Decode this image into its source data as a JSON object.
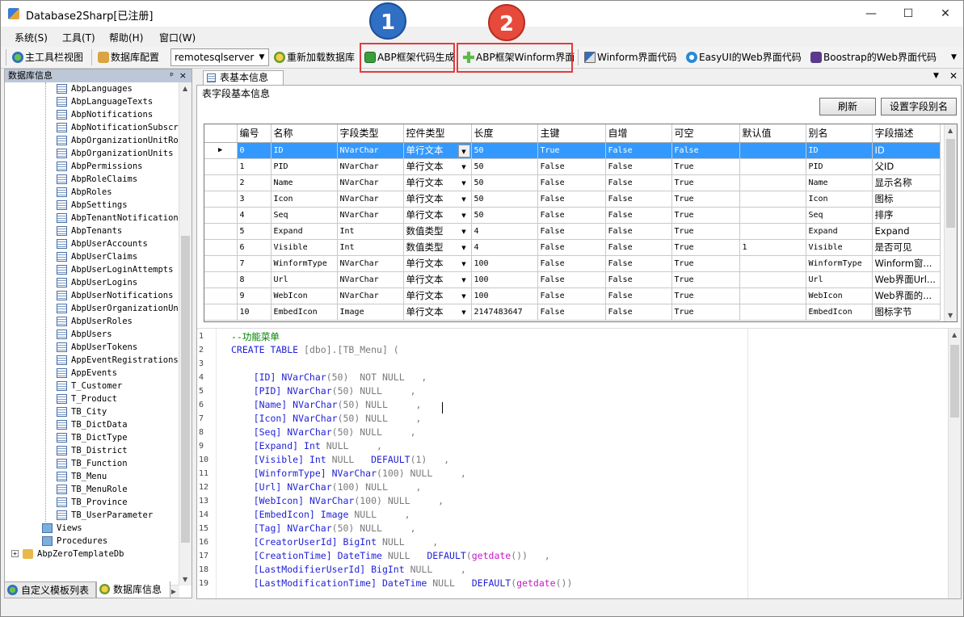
{
  "window": {
    "title": "Database2Sharp[已注册]"
  },
  "menubar": [
    "系统(S)",
    "工具(T)",
    "帮助(H)",
    "窗口(W)"
  ],
  "toolbar": {
    "main_toolbar_view": "主工具栏视图",
    "db_config": "数据库配置",
    "server_selected": "remotesqlserver",
    "reload_db": "重新加载数据库",
    "abp_code_gen": "ABP框架代码生成",
    "abp_winform_ui": "ABP框架Winform界面",
    "winform_ui_code": "Winform界面代码",
    "easyui_web_code": "EasyUI的Web界面代码",
    "bootstrap_web_code": "Boostrap的Web界面代码"
  },
  "badges": [
    "1",
    "2"
  ],
  "left_panel": {
    "title": "数据库信息",
    "pin": "ᵖ",
    "close": "×",
    "tables": [
      "AbpLanguages",
      "AbpLanguageTexts",
      "AbpNotifications",
      "AbpNotificationSubscri",
      "AbpOrganizationUnitRol",
      "AbpOrganizationUnits",
      "AbpPermissions",
      "AbpRoleClaims",
      "AbpRoles",
      "AbpSettings",
      "AbpTenantNotifications",
      "AbpTenants",
      "AbpUserAccounts",
      "AbpUserClaims",
      "AbpUserLoginAttempts",
      "AbpUserLogins",
      "AbpUserNotifications",
      "AbpUserOrganizationUni",
      "AbpUserRoles",
      "AbpUsers",
      "AbpUserTokens",
      "AppEventRegistrations",
      "AppEvents",
      "T_Customer",
      "T_Product",
      "TB_City",
      "TB_DictData",
      "TB_DictType",
      "TB_District",
      "TB_Function",
      "TB_Menu",
      "TB_MenuRole",
      "TB_Province",
      "TB_UserParameter"
    ],
    "views": "Views",
    "procedures": "Procedures",
    "db_node": "AbpZeroTemplateDb",
    "tabs": [
      "自定义模板列表",
      "数据库信息"
    ]
  },
  "doc_tab": "表基本信息",
  "section_label": "表字段基本信息",
  "buttons": {
    "refresh": "刷新",
    "set_alias": "设置字段别名"
  },
  "grid": {
    "columns": [
      "编号",
      "名称",
      "字段类型",
      "控件类型",
      "长度",
      "主键",
      "自增",
      "可空",
      "默认值",
      "别名",
      "字段描述"
    ],
    "rows": [
      [
        "0",
        "ID",
        "NVarChar",
        "单行文本",
        "50",
        "True",
        "False",
        "False",
        "",
        "ID",
        "ID"
      ],
      [
        "1",
        "PID",
        "NVarChar",
        "单行文本",
        "50",
        "False",
        "False",
        "True",
        "",
        "PID",
        "父ID"
      ],
      [
        "2",
        "Name",
        "NVarChar",
        "单行文本",
        "50",
        "False",
        "False",
        "True",
        "",
        "Name",
        "显示名称"
      ],
      [
        "3",
        "Icon",
        "NVarChar",
        "单行文本",
        "50",
        "False",
        "False",
        "True",
        "",
        "Icon",
        "图标"
      ],
      [
        "4",
        "Seq",
        "NVarChar",
        "单行文本",
        "50",
        "False",
        "False",
        "True",
        "",
        "Seq",
        "排序"
      ],
      [
        "5",
        "Expand",
        "Int",
        "数值类型",
        "4",
        "False",
        "False",
        "True",
        "",
        "Expand",
        "Expand"
      ],
      [
        "6",
        "Visible",
        "Int",
        "数值类型",
        "4",
        "False",
        "False",
        "True",
        "1",
        "Visible",
        "是否可见"
      ],
      [
        "7",
        "WinformType",
        "NVarChar",
        "单行文本",
        "100",
        "False",
        "False",
        "True",
        "",
        "WinformType",
        "Winform窗..."
      ],
      [
        "8",
        "Url",
        "NVarChar",
        "单行文本",
        "100",
        "False",
        "False",
        "True",
        "",
        "Url",
        "Web界面Url..."
      ],
      [
        "9",
        "WebIcon",
        "NVarChar",
        "单行文本",
        "100",
        "False",
        "False",
        "True",
        "",
        "WebIcon",
        "Web界面的..."
      ],
      [
        "10",
        "EmbedIcon",
        "Image",
        "单行文本",
        "2147483647",
        "False",
        "False",
        "True",
        "",
        "EmbedIcon",
        "图标字节"
      ]
    ]
  },
  "editor": {
    "line_numbers": [
      "1",
      "2",
      "3",
      "4",
      "5",
      "6",
      "7",
      "8",
      "9",
      "10",
      "11",
      "12",
      "13",
      "14",
      "15",
      "16",
      "17",
      "18",
      "19"
    ],
    "lines": [
      [
        {
          "t": "--功能菜单",
          "c": "cm"
        }
      ],
      [
        {
          "t": "CREATE TABLE ",
          "c": "kw"
        },
        {
          "t": "[dbo].[TB_Menu] (",
          "c": "gr"
        }
      ],
      [],
      [
        {
          "t": "    [ID] ",
          "c": "kw"
        },
        {
          "t": "NVarChar",
          "c": "kw"
        },
        {
          "t": "(50)  NOT NULL   ,",
          "c": "gr"
        }
      ],
      [
        {
          "t": "    [PID] ",
          "c": "kw"
        },
        {
          "t": "NVarChar",
          "c": "kw"
        },
        {
          "t": "(50) NULL     ,",
          "c": "gr"
        }
      ],
      [
        {
          "t": "    [Name] ",
          "c": "kw"
        },
        {
          "t": "NVarChar",
          "c": "kw"
        },
        {
          "t": "(50) NULL     ,",
          "c": "gr"
        }
      ],
      [
        {
          "t": "    [Icon] ",
          "c": "kw"
        },
        {
          "t": "NVarChar",
          "c": "kw"
        },
        {
          "t": "(50) NULL     ,",
          "c": "gr"
        }
      ],
      [
        {
          "t": "    [Seq] ",
          "c": "kw"
        },
        {
          "t": "NVarChar",
          "c": "kw"
        },
        {
          "t": "(50) NULL     ,",
          "c": "gr"
        }
      ],
      [
        {
          "t": "    [Expand] ",
          "c": "kw"
        },
        {
          "t": "Int",
          "c": "kw"
        },
        {
          "t": " NULL     ,",
          "c": "gr"
        }
      ],
      [
        {
          "t": "    [Visible] ",
          "c": "kw"
        },
        {
          "t": "Int",
          "c": "kw"
        },
        {
          "t": " NULL   ",
          "c": "gr"
        },
        {
          "t": "DEFAULT",
          "c": "kw"
        },
        {
          "t": "(1)   ,",
          "c": "gr"
        }
      ],
      [
        {
          "t": "    [WinformType] ",
          "c": "kw"
        },
        {
          "t": "NVarChar",
          "c": "kw"
        },
        {
          "t": "(100) NULL     ,",
          "c": "gr"
        }
      ],
      [
        {
          "t": "    [Url] ",
          "c": "kw"
        },
        {
          "t": "NVarChar",
          "c": "kw"
        },
        {
          "t": "(100) NULL     ,",
          "c": "gr"
        }
      ],
      [
        {
          "t": "    [WebIcon] ",
          "c": "kw"
        },
        {
          "t": "NVarChar",
          "c": "kw"
        },
        {
          "t": "(100) NULL     ,",
          "c": "gr"
        }
      ],
      [
        {
          "t": "    [EmbedIcon] ",
          "c": "kw"
        },
        {
          "t": "Image",
          "c": "kw"
        },
        {
          "t": " NULL     ,",
          "c": "gr"
        }
      ],
      [
        {
          "t": "    [Tag] ",
          "c": "kw"
        },
        {
          "t": "NVarChar",
          "c": "kw"
        },
        {
          "t": "(50) NULL     ,",
          "c": "gr"
        }
      ],
      [
        {
          "t": "    [CreatorUserId] ",
          "c": "kw"
        },
        {
          "t": "BigInt",
          "c": "kw"
        },
        {
          "t": " NULL     ,",
          "c": "gr"
        }
      ],
      [
        {
          "t": "    [CreationTime] ",
          "c": "kw"
        },
        {
          "t": "DateTime",
          "c": "kw"
        },
        {
          "t": " NULL   ",
          "c": "gr"
        },
        {
          "t": "DEFAULT",
          "c": "kw"
        },
        {
          "t": "(",
          "c": "gr"
        },
        {
          "t": "getdate",
          "c": "fn"
        },
        {
          "t": "())   ,",
          "c": "gr"
        }
      ],
      [
        {
          "t": "    [LastModifierUserId] ",
          "c": "kw"
        },
        {
          "t": "BigInt",
          "c": "kw"
        },
        {
          "t": " NULL     ,",
          "c": "gr"
        }
      ],
      [
        {
          "t": "    [LastModificationTime] ",
          "c": "kw"
        },
        {
          "t": "DateTime",
          "c": "kw"
        },
        {
          "t": " NULL   ",
          "c": "gr"
        },
        {
          "t": "DEFAULT",
          "c": "kw"
        },
        {
          "t": "(",
          "c": "gr"
        },
        {
          "t": "getdate",
          "c": "fn"
        },
        {
          "t": "())",
          "c": "gr"
        }
      ]
    ]
  },
  "colors": {
    "highlight_red": "#e23c3c",
    "badge_blue": "#2f6fc4",
    "badge_red": "#e64a3b",
    "selection": "#3399ff"
  }
}
